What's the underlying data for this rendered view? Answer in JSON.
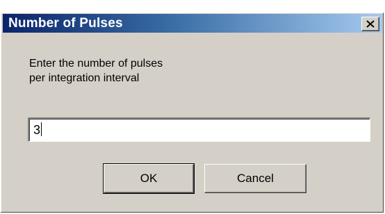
{
  "dialog": {
    "title": "Number of Pulses",
    "prompt_line1": "Enter the number of pulses",
    "prompt_line2": "per integration interval",
    "input_value": "3",
    "ok_label": "OK",
    "cancel_label": "Cancel",
    "close_icon": "close-icon"
  },
  "colors": {
    "titlebar_start": "#0a246a",
    "titlebar_end": "#a6caf0",
    "dialog_face": "#d4d0c8"
  }
}
